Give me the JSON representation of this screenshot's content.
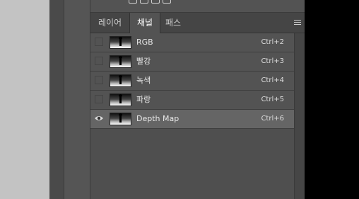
{
  "tabs": [
    {
      "label": "레이어",
      "active": false
    },
    {
      "label": "채널",
      "active": true
    },
    {
      "label": "패스",
      "active": false
    }
  ],
  "channels": [
    {
      "name": "RGB",
      "shortcut": "Ctrl+2",
      "visible": false,
      "selected": false
    },
    {
      "name": "빨강",
      "shortcut": "Ctrl+3",
      "visible": false,
      "selected": false
    },
    {
      "name": "녹색",
      "shortcut": "Ctrl+4",
      "visible": false,
      "selected": false
    },
    {
      "name": "파랑",
      "shortcut": "Ctrl+5",
      "visible": false,
      "selected": false
    },
    {
      "name": "Depth Map",
      "shortcut": "Ctrl+6",
      "visible": true,
      "selected": true
    }
  ],
  "icons": {
    "panel_menu": "hamburger-menu-icon",
    "visibility": "eye-icon",
    "thumbnail": "channel-thumbnail"
  },
  "colors": {
    "panel_bg": "#535353",
    "selected_row": "#656565",
    "canvas_bg": "#c3c3c3"
  }
}
